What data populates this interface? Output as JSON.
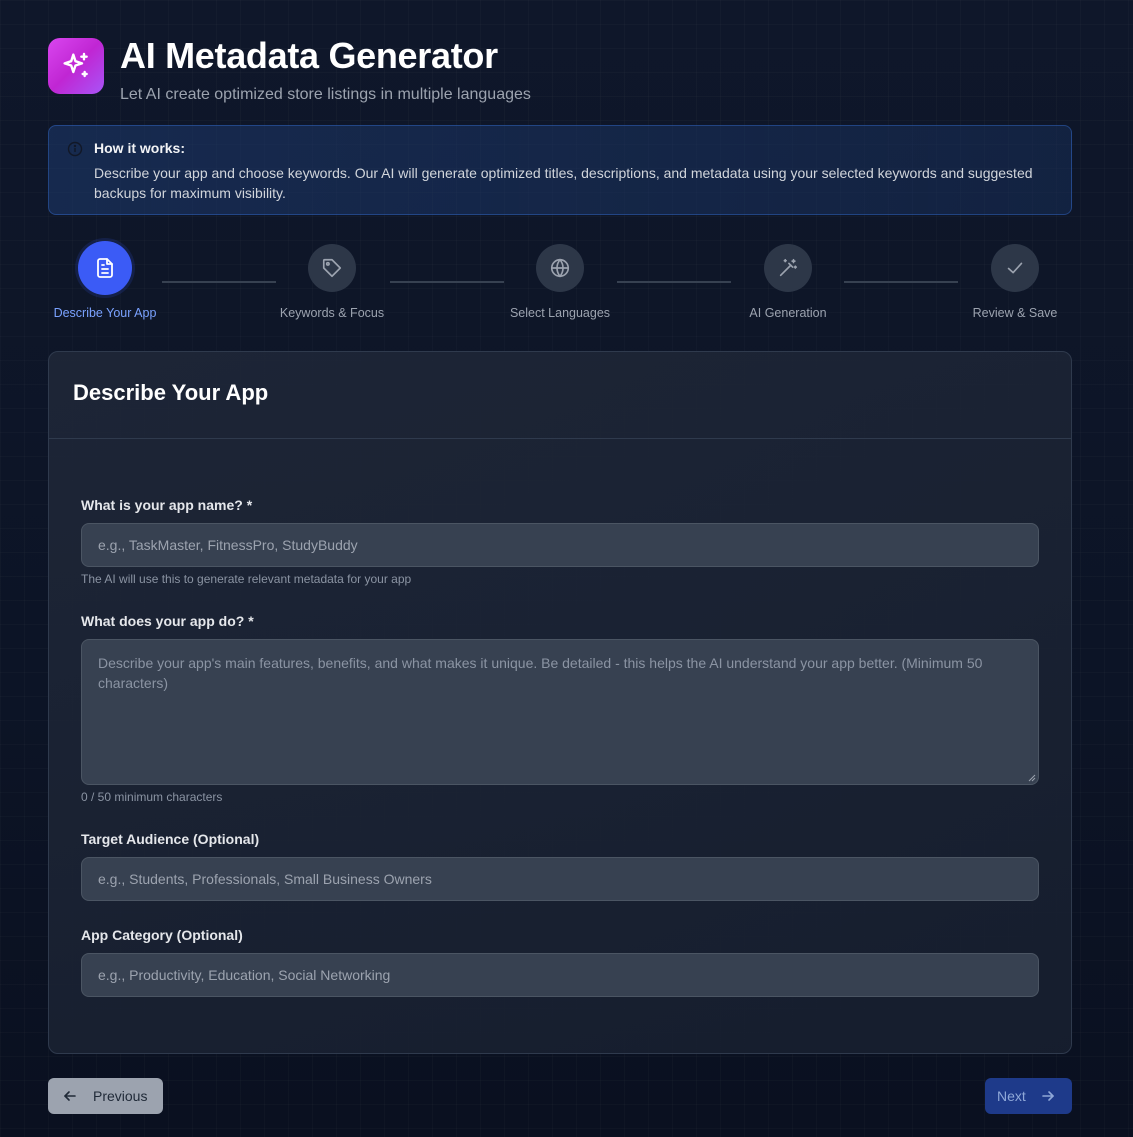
{
  "header": {
    "title": "AI Metadata Generator",
    "subtitle": "Let AI create optimized store listings in multiple languages",
    "logo_icon": "sparkles-icon"
  },
  "info": {
    "title": "How it works:",
    "text": "Describe your app and choose keywords. Our AI will generate optimized titles, descriptions, and metadata using your selected keywords and suggested backups for maximum visibility."
  },
  "steps": [
    {
      "label": "Describe Your App",
      "icon": "document-icon",
      "active": true
    },
    {
      "label": "Keywords & Focus",
      "icon": "tag-icon",
      "active": false
    },
    {
      "label": "Select Languages",
      "icon": "globe-icon",
      "active": false
    },
    {
      "label": "AI Generation",
      "icon": "magic-wand-icon",
      "active": false
    },
    {
      "label": "Review & Save",
      "icon": "check-icon",
      "active": false
    }
  ],
  "form": {
    "title": "Describe Your App",
    "app_name": {
      "label": "What is your app name? *",
      "placeholder": "e.g., TaskMaster, FitnessPro, StudyBuddy",
      "value": "",
      "help": "The AI will use this to generate relevant metadata for your app"
    },
    "description": {
      "label": "What does your app do? *",
      "placeholder": "Describe your app's main features, benefits, and what makes it unique. Be detailed - this helps the AI understand your app better. (Minimum 50 characters)",
      "value": "",
      "counter": "0 / 50 minimum characters"
    },
    "audience": {
      "label": "Target Audience (Optional)",
      "placeholder": "e.g., Students, Professionals, Small Business Owners",
      "value": ""
    },
    "category": {
      "label": "App Category (Optional)",
      "placeholder": "e.g., Productivity, Education, Social Networking",
      "value": ""
    }
  },
  "nav": {
    "previous_label": "Previous",
    "next_label": "Next"
  },
  "colors": {
    "accent": "#3b5bf6",
    "logo_gradient_start": "#d946ef",
    "logo_gradient_end": "#a855f7"
  }
}
